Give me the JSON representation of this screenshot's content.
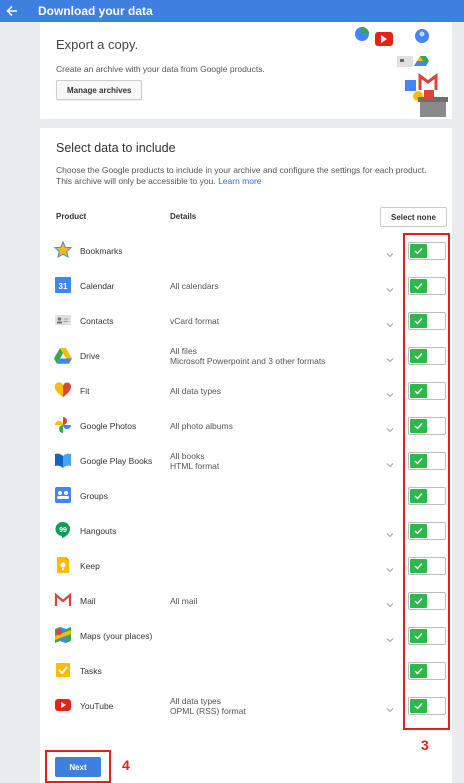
{
  "appbar": {
    "title": "Download your data"
  },
  "export": {
    "title": "Export a copy.",
    "description": "Create an archive with your data from Google products.",
    "manage_label": "Manage archives"
  },
  "select": {
    "title": "Select data to include",
    "description": "Choose the Google products to include in your archive and configure the settings for each product. This archive will only be accessible to you.",
    "learn_more": "Learn more",
    "col_product": "Product",
    "col_details": "Details",
    "select_none": "Select none"
  },
  "products": [
    {
      "name": "Bookmarks",
      "details": [],
      "chevron": true
    },
    {
      "name": "Calendar",
      "details": [
        "All calendars"
      ],
      "chevron": true
    },
    {
      "name": "Contacts",
      "details": [
        "vCard format"
      ],
      "chevron": true
    },
    {
      "name": "Drive",
      "details": [
        "All files",
        "Microsoft Powerpoint and 3 other formats"
      ],
      "chevron": true
    },
    {
      "name": "Fit",
      "details": [
        "All data types"
      ],
      "chevron": true
    },
    {
      "name": "Google Photos",
      "details": [
        "All photo albums"
      ],
      "chevron": true
    },
    {
      "name": "Google Play Books",
      "details": [
        "All books",
        "HTML format"
      ],
      "chevron": true
    },
    {
      "name": "Groups",
      "details": [],
      "chevron": false
    },
    {
      "name": "Hangouts",
      "details": [],
      "chevron": true
    },
    {
      "name": "Keep",
      "details": [],
      "chevron": true
    },
    {
      "name": "Mail",
      "details": [
        "All mail"
      ],
      "chevron": true
    },
    {
      "name": "Maps (your places)",
      "details": [],
      "chevron": true
    },
    {
      "name": "Tasks",
      "details": [],
      "chevron": false
    },
    {
      "name": "YouTube",
      "details": [
        "All data types",
        "OPML (RSS) format"
      ],
      "chevron": true
    }
  ],
  "annotations": {
    "toggles_label": "3",
    "next_label": "4"
  },
  "next_label": "Next",
  "colors": {
    "brand": "#3f7fe0",
    "toggle_on": "#2eb84a",
    "annotation": "#e0201e"
  }
}
